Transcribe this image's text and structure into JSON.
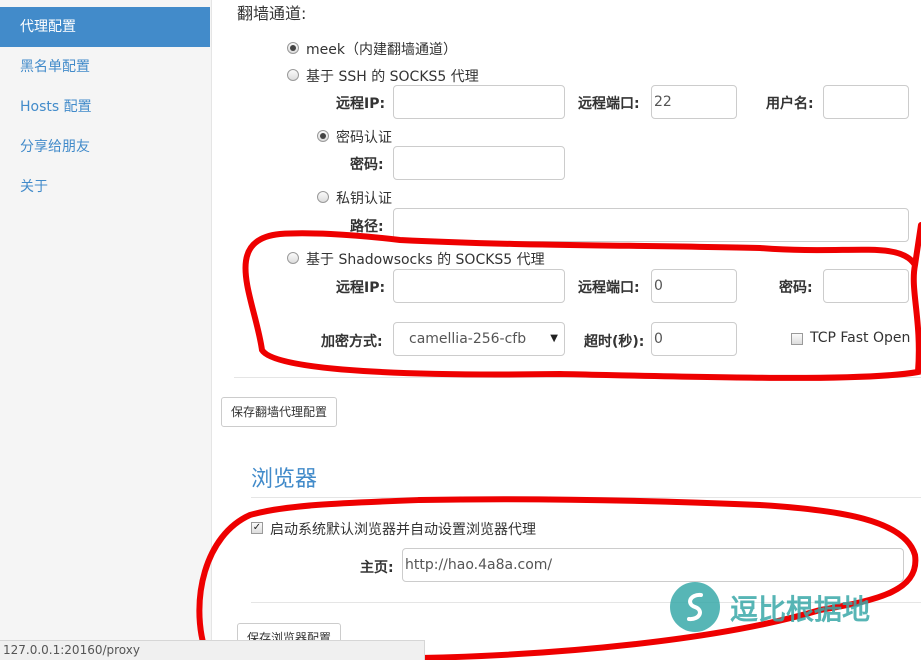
{
  "sidebar": {
    "items": [
      {
        "label": "代理配置",
        "active": true
      },
      {
        "label": "黑名单配置",
        "active": false
      },
      {
        "label": "Hosts 配置",
        "active": false
      },
      {
        "label": "分享给朋友",
        "active": false
      },
      {
        "label": "关于",
        "active": false
      }
    ]
  },
  "proxy": {
    "section_label": "翻墙通道:",
    "meek_option": "meek（内建翻墙通道）",
    "ssh_option": "基于 SSH 的 SOCKS5 代理",
    "ssh": {
      "remote_ip_label": "远程IP:",
      "remote_ip_value": "",
      "remote_port_label": "远程端口:",
      "remote_port_value": "22",
      "username_label": "用户名:",
      "username_value": "",
      "password_auth_option": "密码认证",
      "password_label": "密码:",
      "password_value": "",
      "key_auth_option": "私钥认证",
      "path_label": "路径:",
      "path_value": ""
    },
    "ss_option": "基于 Shadowsocks 的 SOCKS5 代理",
    "ss": {
      "remote_ip_label": "远程IP:",
      "remote_ip_value": "",
      "remote_port_label": "远程端口:",
      "remote_port_value": "0",
      "password_label": "密码:",
      "password_value": "",
      "encryption_label": "加密方式:",
      "encryption_value": "camellia-256-cfb",
      "timeout_label": "超时(秒):",
      "timeout_value": "0",
      "tcp_fast_open_label": "TCP Fast Open"
    },
    "save_button": "保存翻墙代理配置"
  },
  "browser": {
    "title": "浏览器",
    "launch_checkbox": "启动系统默认浏览器并自动设置浏览器代理",
    "homepage_label": "主页:",
    "homepage_value": "http://hao.4a8a.com/",
    "save_button": "保存浏览器配置"
  },
  "status_bar": "127.0.0.1:20160/proxy",
  "watermark": "逗比根据地",
  "colors": {
    "accent": "#428bca",
    "annotation": "#ee0000",
    "watermark": "#3aa9a9"
  }
}
